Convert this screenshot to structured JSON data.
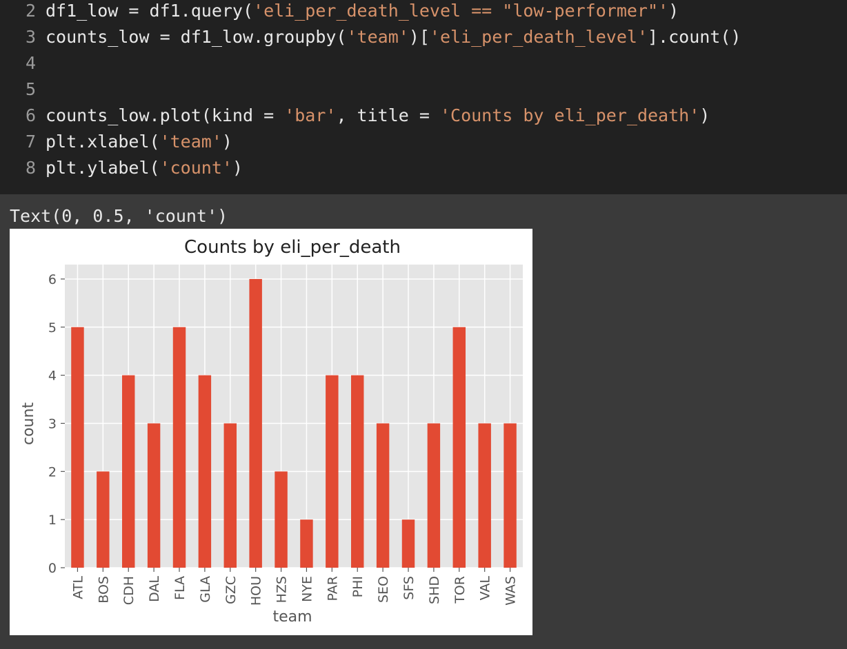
{
  "code": {
    "lines": [
      {
        "num": "2",
        "segments": [
          {
            "t": "df1_low = df1.query(",
            "c": "plain"
          },
          {
            "t": "'eli_per_death_level == \"low-performer\"'",
            "c": "str"
          },
          {
            "t": ")",
            "c": "plain"
          }
        ]
      },
      {
        "num": "3",
        "segments": [
          {
            "t": "counts_low = df1_low.groupby(",
            "c": "plain"
          },
          {
            "t": "'team'",
            "c": "str"
          },
          {
            "t": ")[",
            "c": "plain"
          },
          {
            "t": "'eli_per_death_level'",
            "c": "str"
          },
          {
            "t": "].count()",
            "c": "plain"
          }
        ]
      },
      {
        "num": "4",
        "segments": []
      },
      {
        "num": "5",
        "segments": []
      },
      {
        "num": "6",
        "segments": [
          {
            "t": "counts_low.plot(kind = ",
            "c": "plain"
          },
          {
            "t": "'bar'",
            "c": "str"
          },
          {
            "t": ", title = ",
            "c": "plain"
          },
          {
            "t": "'Counts by eli_per_death'",
            "c": "str"
          },
          {
            "t": ")",
            "c": "plain"
          }
        ]
      },
      {
        "num": "7",
        "segments": [
          {
            "t": "plt.xlabel(",
            "c": "plain"
          },
          {
            "t": "'team'",
            "c": "str"
          },
          {
            "t": ")",
            "c": "plain"
          }
        ]
      },
      {
        "num": "8",
        "segments": [
          {
            "t": "plt.ylabel(",
            "c": "plain"
          },
          {
            "t": "'count'",
            "c": "str"
          },
          {
            "t": ")",
            "c": "plain"
          }
        ]
      }
    ]
  },
  "output": {
    "text": "Text(0, 0.5, 'count')"
  },
  "colors": {
    "bar": "#e24a33",
    "plot_bg": "#e5e5e5",
    "grid": "#ffffff",
    "string": "#d7926a"
  },
  "chart_data": {
    "type": "bar",
    "title": "Counts by eli_per_death",
    "xlabel": "team",
    "ylabel": "count",
    "categories": [
      "ATL",
      "BOS",
      "CDH",
      "DAL",
      "FLA",
      "GLA",
      "GZC",
      "HOU",
      "HZS",
      "NYE",
      "PAR",
      "PHI",
      "SEO",
      "SFS",
      "SHD",
      "TOR",
      "VAL",
      "WAS"
    ],
    "values": [
      5,
      2,
      4,
      3,
      5,
      4,
      3,
      6,
      2,
      1,
      4,
      4,
      3,
      1,
      3,
      5,
      3,
      3
    ],
    "ylim": [
      0,
      6.3
    ],
    "yticks": [
      "0",
      "1",
      "2",
      "3",
      "4",
      "5",
      "6"
    ],
    "grid": true
  }
}
